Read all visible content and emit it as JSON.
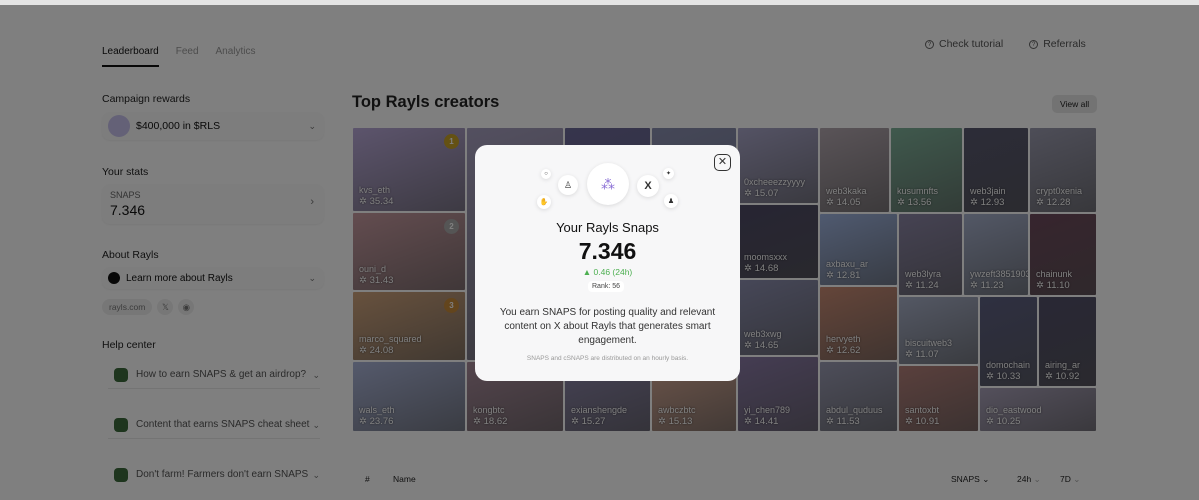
{
  "tabs": [
    {
      "label": "Leaderboard"
    },
    {
      "label": "Feed"
    },
    {
      "label": "Analytics"
    }
  ],
  "top_links": {
    "tutorial": "Check tutorial",
    "referrals": "Referrals"
  },
  "campaign": {
    "title": "Campaign rewards",
    "reward": "$400,000 in $RLS"
  },
  "stats": {
    "title": "Your stats",
    "label": "SNAPS",
    "value": "7.346"
  },
  "about": {
    "title": "About Rayls",
    "learn": "Learn more about Rayls",
    "link": "rayls.com"
  },
  "help": {
    "title": "Help center",
    "items": [
      {
        "label": "How to earn SNAPS & get an airdrop?"
      },
      {
        "label": "Content that earns SNAPS cheat sheet"
      },
      {
        "label": "Don't farm! Farmers don't earn SNAPS"
      }
    ]
  },
  "main": {
    "title": "Top Rayls creators",
    "view_all": "View all"
  },
  "creators": [
    {
      "name": "kvs_eth",
      "score": "35.34",
      "rank": "1",
      "color": "#b9a9d9"
    },
    {
      "name": "ouni_d",
      "score": "31.43",
      "rank": "2",
      "color": "#c79aa0"
    },
    {
      "name": "marco_squared",
      "score": "24.08",
      "rank": "3",
      "color": "#cfa37c"
    },
    {
      "name": "wals_eth",
      "score": "23.76",
      "color": "#aab4d8"
    },
    {
      "name": "kongbtc",
      "score": "18.62",
      "color": "#a88a9a"
    },
    {
      "name": "exianshengde",
      "score": "15.27",
      "color": "#8b84a8"
    },
    {
      "name": "awbczbtc",
      "score": "15.13",
      "color": "#d6a894"
    },
    {
      "name": "0xcheeezzyyyy",
      "score": "15.07",
      "color": "#a9a6c9"
    },
    {
      "name": "moomsxxx",
      "score": "14.68",
      "color": "#4e4a66"
    },
    {
      "name": "web3xwg",
      "score": "14.65",
      "color": "#8d8fb0"
    },
    {
      "name": "yi_chen789",
      "score": "14.41",
      "color": "#8a7aa6"
    },
    {
      "name": "web3kaka",
      "score": "14.05",
      "color": "#b4a8b0"
    },
    {
      "name": "axbaxu_ar",
      "score": "12.81",
      "color": "#9fb4e0"
    },
    {
      "name": "hervyeth",
      "score": "12.62",
      "color": "#c98b74"
    },
    {
      "name": "abdul_quduus",
      "score": "11.53",
      "color": "#9b9cb4"
    },
    {
      "name": "kusumnfts",
      "score": "13.56",
      "color": "#7fb29a"
    },
    {
      "name": "web3lyra",
      "score": "11.24",
      "color": "#8c86a6"
    },
    {
      "name": "biscuitweb3",
      "score": "11.07",
      "color": "#a8b0c8"
    },
    {
      "name": "santoxbt",
      "score": "10.91",
      "color": "#b4807a"
    },
    {
      "name": "web3jain",
      "score": "12.93",
      "color": "#585870"
    },
    {
      "name": "ywzeft3851903",
      "score": "11.23",
      "color": "#a6b0cc"
    },
    {
      "name": "domochain",
      "score": "10.33",
      "color": "#5d6082"
    },
    {
      "name": "crypt0xenia",
      "score": "12.28",
      "color": "#9c9cb0"
    },
    {
      "name": "chainunk",
      "score": "11.10",
      "color": "#6e4a5c"
    },
    {
      "name": "airing_ar",
      "score": "10.92",
      "color": "#52506a"
    },
    {
      "name": "dio_eastwood",
      "score": "10.25",
      "color": "#a8a0b8"
    },
    {
      "name": "",
      "score": "",
      "color": "#a7a0c0"
    },
    {
      "name": "",
      "score": "",
      "color": "#6d6a9a"
    },
    {
      "name": "",
      "score": "",
      "color": "#8a8fb0"
    }
  ],
  "table": {
    "rank": "#",
    "name": "Name",
    "snaps": "SNAPS",
    "h24": "24h",
    "d7": "7D"
  },
  "modal": {
    "title": "Your Rayls Snaps",
    "value": "7.346",
    "change": "▲ 0.46 (24h)",
    "rank": "Rank: 56",
    "body": "You earn SNAPS for posting quality and relevant content on X about Rayls that generates smart engagement.",
    "note": "SNAPS and cSNAPS are distributed on an hourly basis.",
    "change_color": "#4caf50"
  }
}
